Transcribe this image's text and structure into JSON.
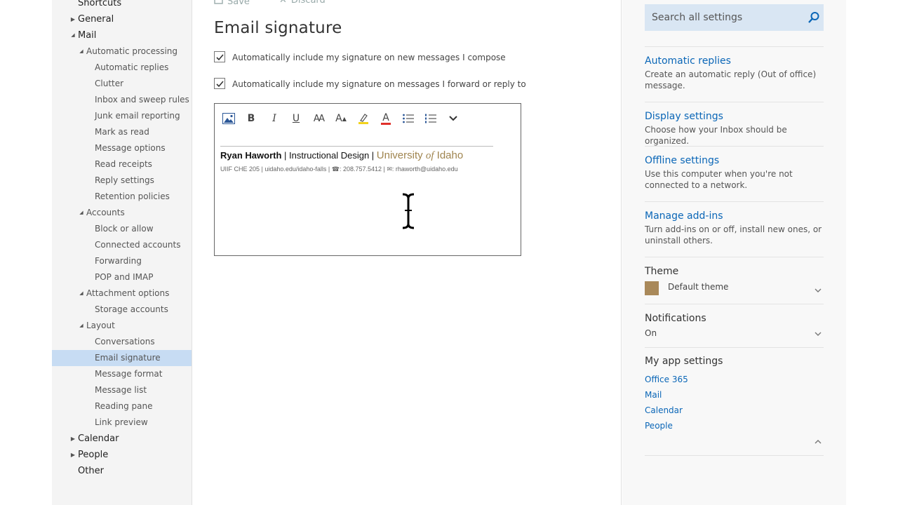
{
  "nav": {
    "items": [
      {
        "label": "Shortcuts",
        "level": 0,
        "arrow": "none"
      },
      {
        "label": "General",
        "level": 0,
        "arrow": "right"
      },
      {
        "label": "Mail",
        "level": 0,
        "arrow": "down"
      },
      {
        "label": "Automatic processing",
        "level": 1,
        "arrow": "down"
      },
      {
        "label": "Automatic replies",
        "level": 2,
        "arrow": "none"
      },
      {
        "label": "Clutter",
        "level": 2,
        "arrow": "none"
      },
      {
        "label": "Inbox and sweep rules",
        "level": 2,
        "arrow": "none"
      },
      {
        "label": "Junk email reporting",
        "level": 2,
        "arrow": "none"
      },
      {
        "label": "Mark as read",
        "level": 2,
        "arrow": "none"
      },
      {
        "label": "Message options",
        "level": 2,
        "arrow": "none"
      },
      {
        "label": "Read receipts",
        "level": 2,
        "arrow": "none"
      },
      {
        "label": "Reply settings",
        "level": 2,
        "arrow": "none"
      },
      {
        "label": "Retention policies",
        "level": 2,
        "arrow": "none"
      },
      {
        "label": "Accounts",
        "level": 1,
        "arrow": "down"
      },
      {
        "label": "Block or allow",
        "level": 2,
        "arrow": "none"
      },
      {
        "label": "Connected accounts",
        "level": 2,
        "arrow": "none"
      },
      {
        "label": "Forwarding",
        "level": 2,
        "arrow": "none"
      },
      {
        "label": "POP and IMAP",
        "level": 2,
        "arrow": "none"
      },
      {
        "label": "Attachment options",
        "level": 1,
        "arrow": "down"
      },
      {
        "label": "Storage accounts",
        "level": 2,
        "arrow": "none"
      },
      {
        "label": "Layout",
        "level": 1,
        "arrow": "down"
      },
      {
        "label": "Conversations",
        "level": 2,
        "arrow": "none"
      },
      {
        "label": "Email signature",
        "level": 2,
        "arrow": "none",
        "selected": true
      },
      {
        "label": "Message format",
        "level": 2,
        "arrow": "none"
      },
      {
        "label": "Message list",
        "level": 2,
        "arrow": "none"
      },
      {
        "label": "Reading pane",
        "level": 2,
        "arrow": "none"
      },
      {
        "label": "Link preview",
        "level": 2,
        "arrow": "none"
      },
      {
        "label": "Calendar",
        "level": 0,
        "arrow": "right"
      },
      {
        "label": "People",
        "level": 0,
        "arrow": "right"
      },
      {
        "label": "Other",
        "level": 0,
        "arrow": "none"
      }
    ]
  },
  "toolbar": {
    "save_label": "Save",
    "discard_label": "Discard"
  },
  "main": {
    "title": "Email signature",
    "checkbox_new": {
      "label": "Automatically include my signature on new messages I compose",
      "checked": true
    },
    "checkbox_reply": {
      "label": "Automatically include my signature on messages I forward or reply to",
      "checked": true
    }
  },
  "editor": {
    "toolbar_icons": [
      "insert-picture-icon",
      "bold-icon",
      "italic-icon",
      "underline-icon",
      "font-size-icon",
      "grow-font-icon",
      "highlight-icon",
      "font-color-icon",
      "bullets-icon",
      "numbering-icon",
      "more-options-icon"
    ],
    "bold": "B",
    "italic": "I",
    "underline": "U",
    "font_size": "AA",
    "grow_font": "A",
    "font_color": "A",
    "signature": {
      "name": "Ryan Haworth",
      "sep1": " |  ",
      "role": "Instructional Design",
      "sep2": "  |  ",
      "uni_a": "University ",
      "uni_of": "of",
      "uni_b": " Idaho",
      "details": "UIIF CHE 205 | uidaho.edu/idaho-falls | ☎: 208.757.5412 | ✉: rhaworth@uidaho.edu"
    }
  },
  "rpane": {
    "search": {
      "placeholder": "Search all settings"
    },
    "links": [
      {
        "title": "Automatic replies",
        "desc": "Create an automatic reply (Out of office) message."
      },
      {
        "title": "Display settings",
        "desc": "Choose how your Inbox should be organized."
      },
      {
        "title": "Offline settings",
        "desc": "Use this computer when you're not connected to a network."
      },
      {
        "title": "Manage add-ins",
        "desc": "Turn add-ins on or off, install new ones, or uninstall others."
      }
    ],
    "theme": {
      "title": "Theme",
      "value": "Default theme",
      "color": "#a9895a"
    },
    "notifications": {
      "title": "Notifications",
      "value": "On"
    },
    "apps": {
      "title": "My app settings",
      "items": [
        "Office 365",
        "Mail",
        "Calendar",
        "People"
      ]
    }
  },
  "colors": {
    "accent": "#0a66b7",
    "selected_nav": "#c7dcf3",
    "university_gold": "#a0854f"
  }
}
